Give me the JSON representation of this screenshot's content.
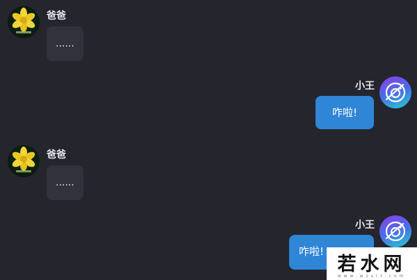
{
  "colors": {
    "background": "#25252e",
    "bubble_received": "#32323d",
    "bubble_sent": "#2f86d6"
  },
  "messages": [
    {
      "sender": "爸爸",
      "side": "left",
      "text": "......",
      "avatar": "flower-avatar"
    },
    {
      "sender": "小王",
      "side": "right",
      "text": "咋啦!",
      "avatar": "globe-avatar"
    },
    {
      "sender": "爸爸",
      "side": "left",
      "text": "......",
      "avatar": "flower-avatar"
    },
    {
      "sender": "小王",
      "side": "right",
      "text": "咋啦!",
      "avatar": "globe-avatar"
    }
  ],
  "watermark": {
    "text": "若水网",
    "subtext": "www.wzsrt.com"
  }
}
